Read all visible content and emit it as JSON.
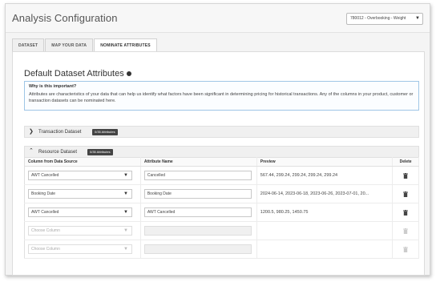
{
  "header": {
    "title": "Analysis Configuration",
    "project_select": "780012 - Overbooking - Weight"
  },
  "tabs": [
    {
      "label": "DATASET"
    },
    {
      "label": "MAP YOUR DATA"
    },
    {
      "label": "NOMINATE ATTRIBUTES"
    }
  ],
  "section": {
    "title": "Default Dataset Attributes"
  },
  "info": {
    "heading": "Why is this important?",
    "text": "Attributes are characteristics of your data that can help us identify what factors have been significant in determining pricing for historical transactions. Any of the columns in your product, customer or transaction datasets can be nominated here."
  },
  "accordions": {
    "transaction": {
      "label": "Transaction Dataset",
      "badge": "0/35 Attributes"
    },
    "resource": {
      "label": "Resource Dataset",
      "badge": "0/35 Attributes"
    }
  },
  "table": {
    "headers": [
      "Column from Data Source",
      "Attribute Name",
      "Preview",
      "Delete"
    ],
    "rows": [
      {
        "column": "AWT Cancelled",
        "attribute": "Cancelled",
        "preview": "567.44, 299.24, 299.24, 299.24, 299.24"
      },
      {
        "column": "Booking Date",
        "attribute": "Booking Date",
        "preview": "2024-06-14, 2023-06-18, 2023-06-26, 2023-07-01, 20..."
      },
      {
        "column": "AWT Cancelled",
        "attribute": "AWT Cancelled",
        "preview": "1200.5, 980.25, 1450.75"
      },
      {
        "column": "Choose Column",
        "attribute": "",
        "preview": ""
      },
      {
        "column": "Choose Column",
        "attribute": "",
        "preview": ""
      }
    ]
  },
  "icons": {
    "delete": "trash-icon",
    "chevron_right": "chevron-right-icon",
    "chevron_up": "chevron-up-icon",
    "caret": "caret-down-icon"
  },
  "colors": {
    "info_border": "#9fc6e6",
    "badge_bg": "#444444"
  }
}
